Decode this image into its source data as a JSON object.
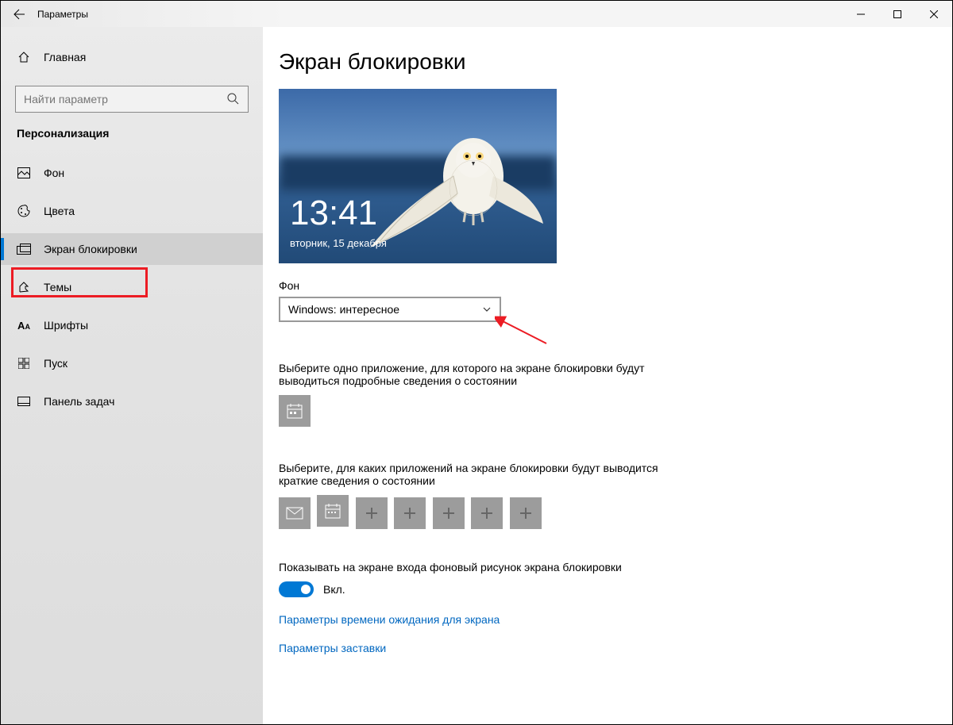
{
  "titlebar": {
    "title": "Параметры"
  },
  "sidebar": {
    "home": "Главная",
    "search_placeholder": "Найти параметр",
    "section": "Персонализация",
    "items": [
      {
        "label": "Фон"
      },
      {
        "label": "Цвета"
      },
      {
        "label": "Экран блокировки"
      },
      {
        "label": "Темы"
      },
      {
        "label": "Шрифты"
      },
      {
        "label": "Пуск"
      },
      {
        "label": "Панель задач"
      }
    ]
  },
  "main": {
    "title": "Экран блокировки",
    "preview": {
      "time": "13:41",
      "date": "вторник, 15 декабря"
    },
    "background_label": "Фон",
    "background_value": "Windows: интересное",
    "detailed_label": "Выберите одно приложение, для которого на экране блокировки будут выводиться подробные сведения о состоянии",
    "quick_label": "Выберите, для каких приложений на экране блокировки будут выводится краткие сведения о состоянии",
    "toggle_label": "Показывать на экране входа фоновый рисунок экрана блокировки",
    "toggle_value": "Вкл.",
    "link_timeout": "Параметры времени ожидания для экрана",
    "link_screensaver": "Параметры заставки"
  }
}
